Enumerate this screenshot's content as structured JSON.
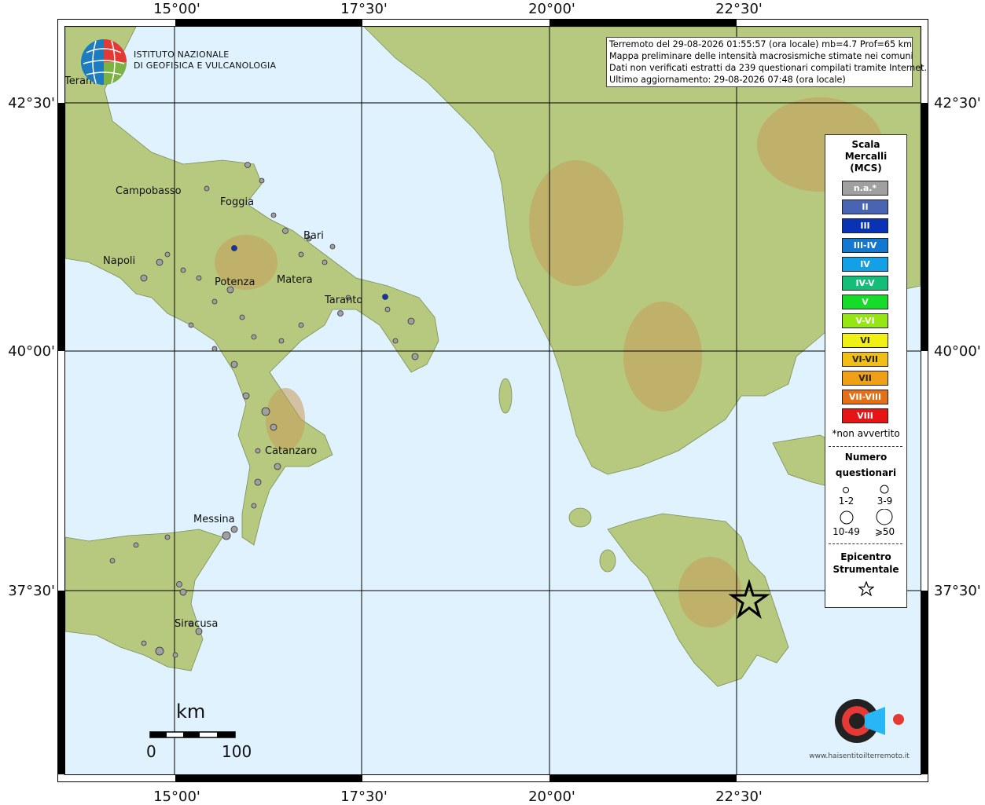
{
  "info": {
    "line1": "Terremoto del 29-08-2026 01:55:57 (ora locale) mb=4.7 Prof=65 km",
    "line2": "Mappa preliminare delle intensità macrosismiche stimate nei comuni",
    "line3": "Dati non verificati estratti da 239 questionari compilati tramite Internet.",
    "line4": "Ultimo aggiornamento: 29-08-2026 07:48 (ora locale)"
  },
  "logo": {
    "line1": "ISTITUTO NAZIONALE",
    "line2": "DI GEOFISICA E VULCANOLOGIA"
  },
  "axes": {
    "top": [
      "15°00'",
      "17°30'",
      "20°00'",
      "22°30'"
    ],
    "bottom": [
      "15°00'",
      "17°30'",
      "20°00'",
      "22°30'"
    ],
    "left": [
      "42°30'",
      "40°00'",
      "37°30'"
    ],
    "right": [
      "42°30'",
      "40°00'",
      "37°30'"
    ]
  },
  "cities": {
    "campobasso": "Campobasso",
    "foggia": "Foggia",
    "bari": "Bari",
    "napoli": "Napoli",
    "potenza": "Potenza",
    "matera": "Matera",
    "taranto": "Taranto",
    "catanzaro": "Catanzaro",
    "messina": "Messina",
    "siracusa": "Siracusa",
    "teramo": "Teramo"
  },
  "legend": {
    "title1": "Scala",
    "title2": "Mercalli",
    "title3": "(MCS)",
    "classes": [
      {
        "label": "n.a.*",
        "color": "#a0a0a0"
      },
      {
        "label": "II",
        "color": "#4a64b4"
      },
      {
        "label": "III",
        "color": "#0a32b4"
      },
      {
        "label": "III-IV",
        "color": "#1478d2"
      },
      {
        "label": "IV",
        "color": "#14a0e6"
      },
      {
        "label": "IV-V",
        "color": "#14be78"
      },
      {
        "label": "V",
        "color": "#14dc28"
      },
      {
        "label": "V-VI",
        "color": "#96e614"
      },
      {
        "label": "VI",
        "color": "#f0f014"
      },
      {
        "label": "VI-VII",
        "color": "#f0be14"
      },
      {
        "label": "VII",
        "color": "#f0a014"
      },
      {
        "label": "VII-VIII",
        "color": "#e66e14"
      },
      {
        "label": "VIII",
        "color": "#e61414"
      }
    ],
    "note": "*non avvertito",
    "q_title1": "Numero",
    "q_title2": "questionari",
    "sizes": [
      "1-2",
      "3-9",
      "10-49",
      "⩾50"
    ],
    "epi1": "Epicentro",
    "epi2": "Strumentale"
  },
  "scale_bar": {
    "unit": "km",
    "min": "0",
    "max": "100"
  },
  "watermark": "www.haisentitoilterremoto.it"
}
